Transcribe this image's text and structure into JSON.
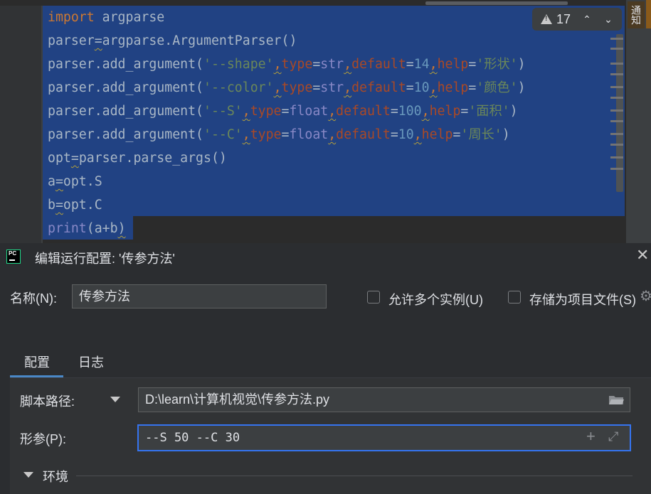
{
  "editor": {
    "lines": [
      {
        "id": "l1",
        "parts": [
          {
            "t": "import",
            "c": "kw"
          },
          {
            "t": " argparse",
            "c": ""
          }
        ]
      },
      {
        "id": "l2",
        "parts": [
          {
            "t": "parser",
            "c": ""
          },
          {
            "t": "=",
            "c": "squig"
          },
          {
            "t": "argparse.ArgumentParser()",
            "c": ""
          }
        ]
      },
      {
        "id": "l3",
        "parts": [
          {
            "t": "parser.add_argument(",
            "c": ""
          },
          {
            "t": "'--shape'",
            "c": "str"
          },
          {
            "t": ",",
            "c": "kw squig"
          },
          {
            "t": "type",
            "c": "param"
          },
          {
            "t": "=",
            "c": ""
          },
          {
            "t": "str",
            "c": "fn"
          },
          {
            "t": ",",
            "c": "kw squig"
          },
          {
            "t": "default",
            "c": "param"
          },
          {
            "t": "=",
            "c": ""
          },
          {
            "t": "14",
            "c": "num"
          },
          {
            "t": ",",
            "c": "kw squig"
          },
          {
            "t": "help",
            "c": "param"
          },
          {
            "t": "=",
            "c": ""
          },
          {
            "t": "'形状'",
            "c": "str"
          },
          {
            "t": ")",
            "c": ""
          }
        ]
      },
      {
        "id": "l4",
        "parts": [
          {
            "t": "parser.add_argument(",
            "c": ""
          },
          {
            "t": "'--color'",
            "c": "str"
          },
          {
            "t": ",",
            "c": "kw squig"
          },
          {
            "t": "type",
            "c": "param"
          },
          {
            "t": "=",
            "c": ""
          },
          {
            "t": "str",
            "c": "fn"
          },
          {
            "t": ",",
            "c": "kw squig"
          },
          {
            "t": "default",
            "c": "param"
          },
          {
            "t": "=",
            "c": ""
          },
          {
            "t": "10",
            "c": "num"
          },
          {
            "t": ",",
            "c": "kw squig"
          },
          {
            "t": "help",
            "c": "param"
          },
          {
            "t": "=",
            "c": ""
          },
          {
            "t": "'颜色'",
            "c": "str"
          },
          {
            "t": ")",
            "c": ""
          }
        ]
      },
      {
        "id": "l5",
        "parts": [
          {
            "t": "parser.add_argument(",
            "c": ""
          },
          {
            "t": "'--S'",
            "c": "str"
          },
          {
            "t": ",",
            "c": "kw squig"
          },
          {
            "t": "type",
            "c": "param"
          },
          {
            "t": "=",
            "c": ""
          },
          {
            "t": "float",
            "c": "fn"
          },
          {
            "t": ",",
            "c": "kw squig"
          },
          {
            "t": "default",
            "c": "param"
          },
          {
            "t": "=",
            "c": ""
          },
          {
            "t": "100",
            "c": "num"
          },
          {
            "t": ",",
            "c": "kw squig"
          },
          {
            "t": "help",
            "c": "param"
          },
          {
            "t": "=",
            "c": ""
          },
          {
            "t": "'面积'",
            "c": "str"
          },
          {
            "t": ")",
            "c": ""
          }
        ]
      },
      {
        "id": "l6",
        "parts": [
          {
            "t": "parser.add_argument(",
            "c": ""
          },
          {
            "t": "'--C'",
            "c": "str"
          },
          {
            "t": ",",
            "c": "kw squig"
          },
          {
            "t": "type",
            "c": "param"
          },
          {
            "t": "=",
            "c": ""
          },
          {
            "t": "float",
            "c": "fn"
          },
          {
            "t": ",",
            "c": "kw squig"
          },
          {
            "t": "default",
            "c": "param"
          },
          {
            "t": "=",
            "c": ""
          },
          {
            "t": "10",
            "c": "num"
          },
          {
            "t": ",",
            "c": "kw squig"
          },
          {
            "t": "help",
            "c": "param"
          },
          {
            "t": "=",
            "c": ""
          },
          {
            "t": "'周长'",
            "c": "str"
          },
          {
            "t": ")",
            "c": ""
          }
        ]
      },
      {
        "id": "l7",
        "parts": [
          {
            "t": "opt",
            "c": ""
          },
          {
            "t": "=",
            "c": "squig"
          },
          {
            "t": "parser.parse_args()",
            "c": ""
          }
        ]
      },
      {
        "id": "l8",
        "parts": [
          {
            "t": "a",
            "c": ""
          },
          {
            "t": "=",
            "c": "squig"
          },
          {
            "t": "opt.S",
            "c": ""
          }
        ]
      },
      {
        "id": "l9",
        "parts": [
          {
            "t": "b",
            "c": ""
          },
          {
            "t": "=",
            "c": "squig"
          },
          {
            "t": "opt.C",
            "c": ""
          }
        ]
      },
      {
        "id": "l10",
        "parts": [
          {
            "t": "print",
            "c": "fn"
          },
          {
            "t": "(a+b",
            "c": ""
          },
          {
            "t": ")",
            "c": "squig"
          }
        ]
      }
    ],
    "inspection": {
      "count": "17",
      "up_icon": "chevron-up-icon",
      "down_icon": "chevron-down-icon"
    },
    "notification_tab": "通知"
  },
  "dialog": {
    "title": "编辑运行配置: '传参方法'",
    "close_glyph": "✕",
    "name_label": "名称(N):",
    "name_value": "传参方法",
    "allow_multiple_label": "允许多个实例(U)",
    "allow_multiple_checked": false,
    "store_as_project_label": "存储为项目文件(S)",
    "store_as_project_checked": false,
    "tabs": [
      {
        "label": "配置",
        "active": true
      },
      {
        "label": "日志",
        "active": false
      }
    ],
    "script_path_label": "脚本路径:",
    "script_path_value": "D:\\learn\\计算机视觉\\传参方法.py",
    "params_label": "形参(P):",
    "params_value": "--S 50 --C 30",
    "env_label": "环境"
  },
  "colors": {
    "selection": "#214283",
    "keyword": "#cc7832",
    "string": "#6a8759",
    "number": "#6897bb",
    "param": "#aa4926",
    "focus": "#3574f0",
    "tab_underline": "#4a88c7"
  }
}
